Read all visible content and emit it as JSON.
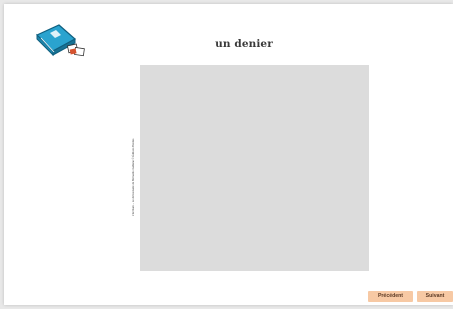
{
  "card": {
    "title": "un denier",
    "credit": "L'Ecriture – Le dictionnaire de Bernardo Galliane © Éditions Bordas"
  },
  "logo": {
    "icon": "book-with-cards-icon",
    "color": "#2aa3cf"
  },
  "navigation": {
    "prev_label": "Précédent",
    "next_label": "Suivant",
    "button_color": "#f7c9a4"
  }
}
